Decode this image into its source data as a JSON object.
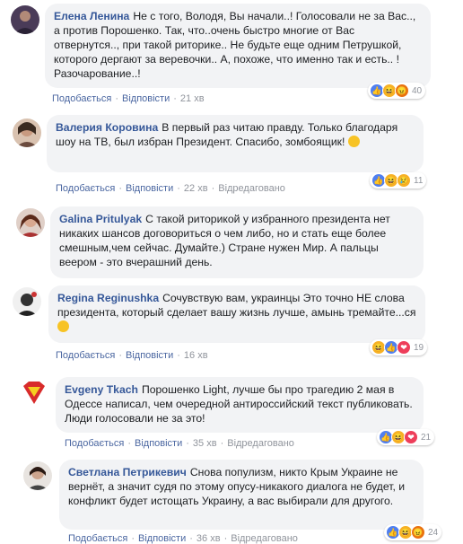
{
  "comments": [
    {
      "author": "Елена Ленина",
      "text": "Не с того, Володя, Вы начали..! Голосовали не за Вас.., а против Порошенко. Так, что..очень быстро многие от Вас отвернутся.., при такой риторике.. Не будьте еще одним Петрушкой, которого дергают за веревочки.. А, похоже, что именно так и есть.. ! Разочарование..!",
      "like": "Подобається",
      "reply": "Відповісти",
      "time": "21 хв",
      "edited": "",
      "reaction_count": "40",
      "reactions": [
        "like-icon",
        "haha-icon",
        "angry-icon"
      ]
    },
    {
      "author": "Валерия Коровина",
      "text": "В первый раз читаю правду. Только благодаря шоу на ТВ, был избран Президент. Спасибо, зомбоящик!",
      "like": "Подобається",
      "reply": "Відповісти",
      "time": "22 хв",
      "edited": "Відредаговано",
      "reaction_count": "11",
      "reactions": [
        "like-icon",
        "haha-icon",
        "sad-icon"
      ]
    },
    {
      "author": "Galina Pritulyak",
      "text": "С такой риторикой у избранного президента нет никаких шансов договориться о чем либо, но и стать еще более смешным,чем сейчас. Думайте.) Стране нужен Мир. А пальцы веером - это вчерашний день.",
      "like": "",
      "reply": "",
      "time": "",
      "edited": "",
      "reaction_count": "",
      "reactions": []
    },
    {
      "author": "Regina Reginushka",
      "text": "Сочувствую вам, украинцы Это точно НЕ слова президента, который сделает вашу жизнь лучше, амынь тремайте...ся",
      "like": "Подобається",
      "reply": "Відповісти",
      "time": "16 хв",
      "edited": "",
      "reaction_count": "19",
      "reactions": [
        "haha-icon",
        "like-icon",
        "love-icon"
      ]
    },
    {
      "author": "Evgeny Tkach",
      "text": "Порошенко Light, лучше бы про трагедию 2 мая в Одессе написал, чем очередной антироссийский текст публиковать. Люди голосовали не за это!",
      "like": "Подобається",
      "reply": "Відповісти",
      "time": "35 хв",
      "edited": "Відредаговано",
      "reaction_count": "21",
      "reactions": [
        "like-icon",
        "haha-icon",
        "love-icon"
      ]
    },
    {
      "author": "Светлана Петрикевич",
      "text": "Снова популизм, никто Крым Украине не вернёт, а значит судя по этому опусу-никакого диалога не будет, и конфликт будет истощать Украину, а вас выбирали для другого.",
      "like": "Подобається",
      "reply": "Відповісти",
      "time": "36 хв",
      "edited": "Відредаговано",
      "reaction_count": "24",
      "reactions": [
        "like-icon",
        "haha-icon",
        "angry-icon"
      ]
    }
  ],
  "colors": {
    "author": "#365899",
    "bubble": "#f2f3f5",
    "meta": "#90949c",
    "link": "#4b67a1"
  }
}
